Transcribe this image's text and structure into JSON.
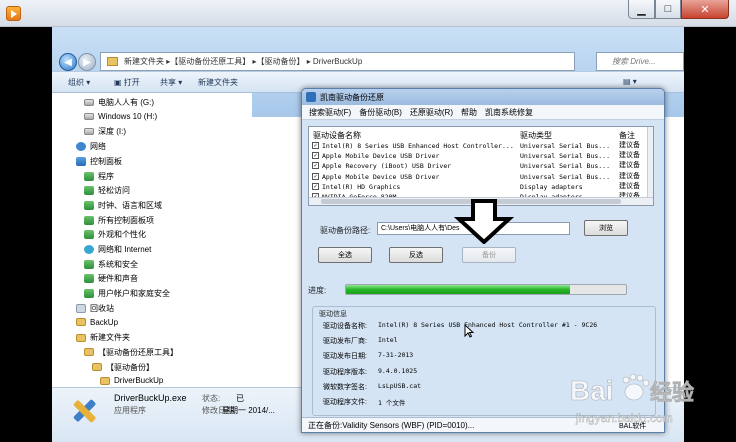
{
  "explorer": {
    "address_path": "新建文件夹 ▸【驱动备份还原工具】 ▸【驱动备份】 ▸ DriverBuckUp",
    "search_placeholder": "搜索 Drive...",
    "toolbar": {
      "organize": "组织 ▾",
      "open": "打开",
      "share": "共享 ▾",
      "new_folder": "新建文件夹"
    }
  },
  "nav_tree": [
    {
      "label": "电脑人人有 (G:)",
      "icon": "drive-icon",
      "indent": 1
    },
    {
      "label": "Windows 10 (H:)",
      "icon": "drive-icon",
      "indent": 1
    },
    {
      "label": "深度 (I:)",
      "icon": "drive-icon",
      "indent": 1
    },
    {
      "label": "网络",
      "icon": "network-icon",
      "indent": 0
    },
    {
      "label": "控制面板",
      "icon": "control-panel-icon",
      "indent": 0
    },
    {
      "label": "程序",
      "icon": "programs-icon",
      "indent": 1
    },
    {
      "label": "轻松访问",
      "icon": "ease-access-icon",
      "indent": 1
    },
    {
      "label": "时钟、语言和区域",
      "icon": "clock-region-icon",
      "indent": 1
    },
    {
      "label": "所有控制面板项",
      "icon": "all-items-icon",
      "indent": 1
    },
    {
      "label": "外观和个性化",
      "icon": "appearance-icon",
      "indent": 1
    },
    {
      "label": "网络和 Internet",
      "icon": "globe-icon",
      "indent": 1
    },
    {
      "label": "系统和安全",
      "icon": "security-icon",
      "indent": 1
    },
    {
      "label": "硬件和声音",
      "icon": "hardware-icon",
      "indent": 1
    },
    {
      "label": "用户帐户和家庭安全",
      "icon": "user-accounts-icon",
      "indent": 1
    },
    {
      "label": "回收站",
      "icon": "recycle-bin-icon",
      "indent": 0
    },
    {
      "label": "BackUp",
      "icon": "folder-icon",
      "indent": 0
    },
    {
      "label": "新建文件夹",
      "icon": "folder-icon",
      "indent": 0
    },
    {
      "label": "【驱动备份还原工具】",
      "icon": "folder-icon",
      "indent": 1
    },
    {
      "label": "【驱动备份】",
      "icon": "folder-icon",
      "indent": 2
    },
    {
      "label": "DriverBuckUp",
      "icon": "folder-icon",
      "indent": 3
    }
  ],
  "details": {
    "file_name": "DriverBuckUp.exe",
    "file_type": "应用程序",
    "state_label": "状态:",
    "state_value": "已",
    "date_label": "修改日期:",
    "date_value": "星期一 2014/..."
  },
  "dialog": {
    "title": "凯南驱动备份还原",
    "menu": [
      "搜索驱动(F)",
      "备份驱动(B)",
      "还原驱动(R)",
      "帮助",
      "凯南系统修复"
    ],
    "columns": [
      "驱动设备名称",
      "驱动类型",
      "备注"
    ],
    "rows": [
      {
        "name": "Intel(R) 8 Series USB Enhanced Host Controller...",
        "type": "Universal Serial Bus...",
        "note": "建议备"
      },
      {
        "name": "Apple Mobile Device USB Driver",
        "type": "Universal Serial Bus...",
        "note": "建议备"
      },
      {
        "name": "Apple Recovery (iBoot) USB Driver",
        "type": "Universal Serial Bus...",
        "note": "建议备"
      },
      {
        "name": "Apple Mobile Device USB Driver",
        "type": "Universal Serial Bus...",
        "note": "建议备"
      },
      {
        "name": "Intel(R) HD Graphics",
        "type": "Display adapters",
        "note": "建议备"
      },
      {
        "name": "NVIDIA GeForce 820M",
        "type": "Display adapters",
        "note": "建议备"
      }
    ],
    "path_label": "驱动备份路径:",
    "path_value": "C:\\Users\\电脑人人有\\Des",
    "browse_label": "浏览",
    "select_all_label": "全选",
    "invert_label": "反选",
    "backup_label": "备份",
    "progress_label": "进度:",
    "progress_fraction": 0.8,
    "info_title": "驱动信息",
    "info": [
      {
        "label": "驱动设备名称:",
        "value": "Intel(R) 8 Series USB Enhanced Host Controller #1 - 9C26"
      },
      {
        "label": "驱动发布厂商:",
        "value": "Intel"
      },
      {
        "label": "驱动发布日期:",
        "value": "7-31-2013"
      },
      {
        "label": "驱动程序版本:",
        "value": "9.4.0.1025"
      },
      {
        "label": "微软数字签名:",
        "value": "LsLpUSB.cat"
      },
      {
        "label": "驱动程序文件:",
        "value": "1 个文件"
      }
    ],
    "status": "正在备份:Validity Sensors (WBF) (PID=0010)...",
    "status_right": "BAL软件"
  },
  "watermark": {
    "brand": "Bai",
    "brand2": "经验",
    "url": "jingyan.baidu.com"
  }
}
